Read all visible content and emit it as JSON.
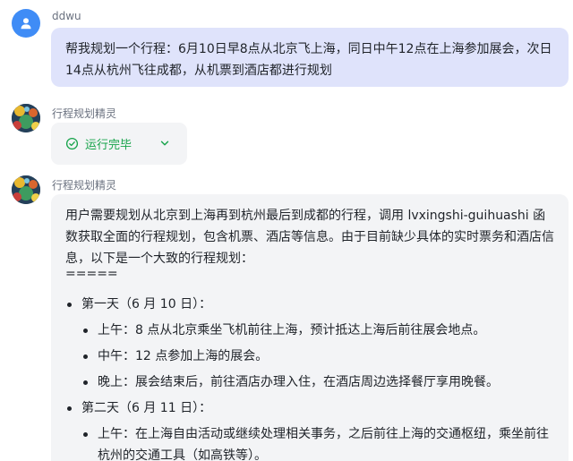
{
  "colors": {
    "user_bubble": "#dfe3fb",
    "bot_bubble": "#f3f4f6",
    "user_avatar": "#3f8cf6",
    "status_ok": "#16a34a"
  },
  "user_message": {
    "sender": "ddwu",
    "avatar_icon": "user-icon",
    "text": "帮我规划一个行程：6月10日早8点从北京飞上海，同日中午12点在上海参加展会，次日14点从杭州飞往成都，从机票到酒店都进行规划"
  },
  "status_message": {
    "sender": "行程规划精灵",
    "icon": "check-circle-icon",
    "label": "运行完毕",
    "toggle_icon": "chevron-down-icon"
  },
  "reply_message": {
    "sender": "行程规划精灵",
    "intro": "用户需要规划从北京到上海再到杭州最后到成都的行程，调用 lvxingshi-guihuashi 函数获取全面的行程规划，包含机票、酒店等信息。由于目前缺少具体的实时票务和酒店信息，以下是一个大致的行程规划：",
    "separator": "=====",
    "days": [
      {
        "label": "第一天（6 月 10 日）：",
        "items": [
          "上午：8 点从北京乘坐飞机前往上海，预计抵达上海后前往展会地点。",
          "中午：12 点参加上海的展会。",
          "晚上：展会结束后，前往酒店办理入住，在酒店周边选择餐厅享用晚餐。"
        ]
      },
      {
        "label": "第二天（6 月 11 日）：",
        "items": [
          "上午：在上海自由活动或继续处理相关事务，之后前往上海的交通枢纽，乘坐前往杭州的交通工具（如高铁等）。"
        ]
      }
    ]
  }
}
